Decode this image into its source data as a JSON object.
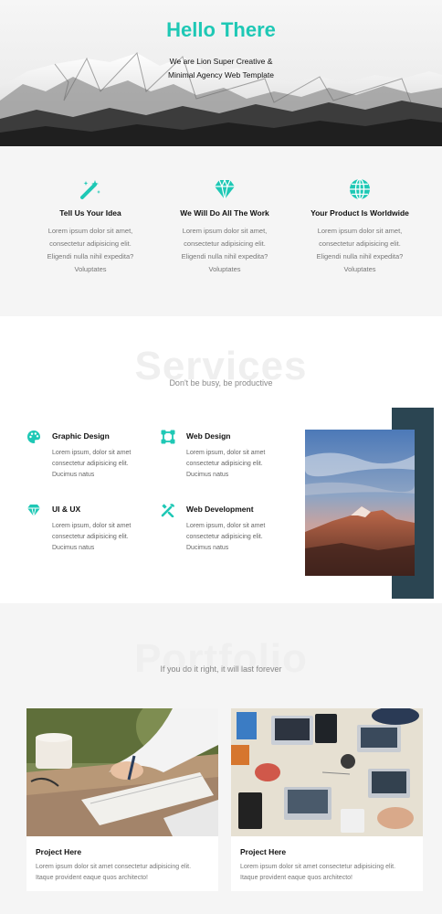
{
  "hero": {
    "title": "Hello There",
    "subtitle_line1": "We are Lion Super Creative &",
    "subtitle_line2": "Minimal Agency Web Template"
  },
  "features": [
    {
      "icon": "magic-wand-icon",
      "title": "Tell Us Your Idea",
      "text": [
        "Lorem ipsum dolor sit amet,",
        "consectetur adipisicing elit.",
        "Eligendi nulla nihil expedita?",
        "Voluptates"
      ]
    },
    {
      "icon": "diamond-icon",
      "title": "We Will Do All The Work",
      "text": [
        "Lorem ipsum dolor sit amet,",
        "consectetur adipisicing elit.",
        "Eligendi nulla nihil expedita?",
        "Voluptates"
      ]
    },
    {
      "icon": "globe-icon",
      "title": "Your Product Is Worldwide",
      "text": [
        "Lorem ipsum dolor sit amet,",
        "consectetur adipisicing elit.",
        "Eligendi nulla nihil expedita?",
        "Voluptates"
      ]
    }
  ],
  "services": {
    "heading": "Services",
    "subtitle": "Don't be busy, be productive",
    "items": [
      {
        "icon": "palette-icon",
        "title": "Graphic Design",
        "text": [
          "Lorem ipsum, dolor sit amet",
          "consectetur adipisicing elit.",
          "Ducimus natus"
        ]
      },
      {
        "icon": "vector-square-icon",
        "title": "Web Design",
        "text": [
          "Lorem ipsum, dolor sit amet",
          "consectetur adipisicing elit.",
          "Ducimus natus"
        ]
      },
      {
        "icon": "diamond-icon",
        "title": "UI & UX",
        "text": [
          "Lorem ipsum, dolor sit amet",
          "consectetur adipisicing elit.",
          "Ducimus natus"
        ]
      },
      {
        "icon": "tools-icon",
        "title": "Web Development",
        "text": [
          "Lorem ipsum, dolor sit amet",
          "consectetur adipisicing elit.",
          "Ducimus natus"
        ]
      }
    ]
  },
  "portfolio": {
    "heading": "Portfolio",
    "subtitle": "If you do it right, it will last forever",
    "projects": [
      {
        "title": "Project Here",
        "text": [
          "Lorem ipsum dolor sit amet consectetur adipisicing elit.",
          "Itaque provident eaque quos architecto!"
        ]
      },
      {
        "title": "Project Here",
        "text": [
          "Lorem ipsum dolor sit amet consectetur adipisicing elit.",
          "Itaque provident eaque quos architecto!"
        ]
      }
    ]
  },
  "colors": {
    "accent": "#1ec8b5",
    "dark_block": "#2b4552",
    "section_bg": "#f5f5f5"
  }
}
